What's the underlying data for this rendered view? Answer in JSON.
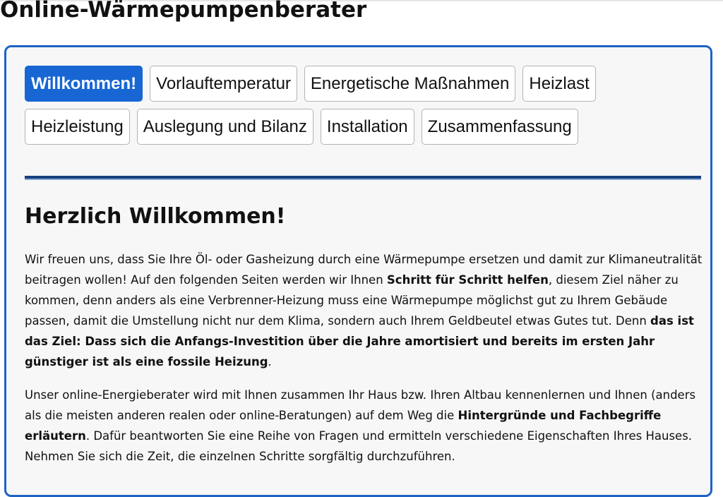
{
  "page": {
    "title": "Online-Wärmepumpenberater"
  },
  "tabs": {
    "row1": [
      "Willkommen!",
      "Vorlauftemperatur",
      "Energetische Maßnahmen",
      "Heizlast"
    ],
    "row2": [
      "Heizleistung",
      "Auslegung und Bilanz",
      "Installation",
      "Zusammenfassung"
    ],
    "active": "Willkommen!"
  },
  "section": {
    "heading": "Herzlich Willkommen!",
    "p1": {
      "t1": "Wir freuen uns, dass Sie Ihre Öl- oder Gasheizung durch eine Wärmepumpe ersetzen und damit zur Klimaneutralität beitragen wollen! Auf den folgenden Seiten werden wir Ihnen ",
      "b1": "Schritt für Schritt helfen",
      "t2": ", diesem Ziel näher zu kommen, denn anders als eine Verbrenner-Heizung muss eine Wärmepumpe möglichst gut zu Ihrem Gebäude passen, damit die Umstellung nicht nur dem Klima, sondern auch Ihrem Geldbeutel etwas Gutes tut. Denn ",
      "b2": "das ist das Ziel: Dass sich die Anfangs-Investition über die Jahre amortisiert und bereits im ersten Jahr günstiger ist als eine fossile Heizung",
      "t3": "."
    },
    "p2": {
      "t1": "Unser online-Energieberater wird mit Ihnen zusammen Ihr Haus bzw. Ihren Altbau kennenlernen und Ihnen (anders als die meisten anderen realen oder online-Beratungen) auf dem Weg die ",
      "b1": "Hintergründe und Fachbegriffe erläutern",
      "t2": ". Dafür beantworten Sie eine Reihe von Fragen und ermitteln verschiedene Eigenschaften Ihres Hauses. Nehmen Sie sich die Zeit, die einzelnen Schritte sorgfältig durchzuführen."
    }
  },
  "colors": {
    "accent": "#1766d4",
    "panel_border": "#1e63c4",
    "divider": "#16407e"
  }
}
